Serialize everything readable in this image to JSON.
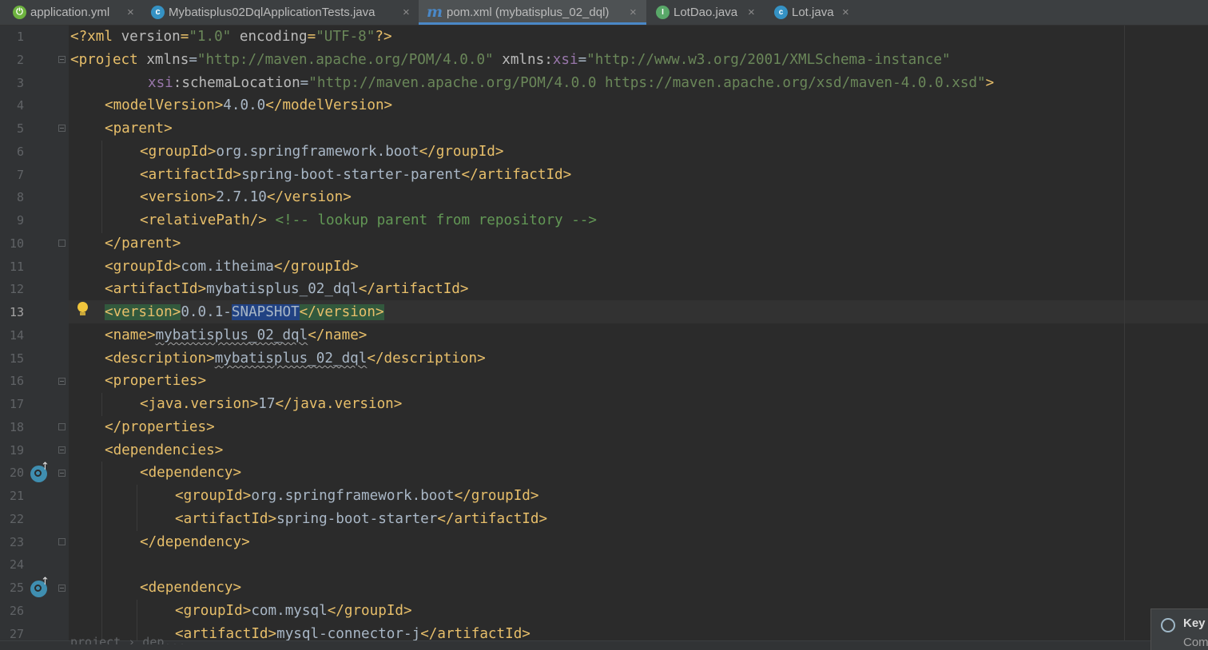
{
  "tabs": [
    {
      "label": "application.yml",
      "icon": "spring-boot-config-icon",
      "active": false
    },
    {
      "label": "Mybatisplus02DqlApplicationTests.java",
      "icon": "test-class-icon",
      "active": false
    },
    {
      "label": "pom.xml (mybatisplus_02_dql)",
      "icon": "maven-icon",
      "active": true
    },
    {
      "label": "LotDao.java",
      "icon": "interface-icon",
      "active": false
    },
    {
      "label": "Lot.java",
      "icon": "class-icon",
      "active": false
    }
  ],
  "tab_icon_glyphs": {
    "spring": "⏻",
    "test": "c",
    "iface": "I",
    "cls": "c",
    "maven": "m"
  },
  "close_glyph": "×",
  "line_numbers": [
    "1",
    "2",
    "3",
    "4",
    "5",
    "6",
    "7",
    "8",
    "9",
    "10",
    "11",
    "12",
    "13",
    "14",
    "15",
    "16",
    "17",
    "18",
    "19",
    "20",
    "21",
    "22",
    "23",
    "24",
    "25",
    "26",
    "27"
  ],
  "current_line": "13",
  "code": {
    "l1": {
      "open": "<?xml ",
      "a1": "version",
      "v1": "\"1.0\"",
      "a2": " encoding",
      "v2": "\"UTF-8\"",
      "close": "?>"
    },
    "l2": {
      "open": "<project ",
      "a1": "xmlns",
      "v1": "\"http://maven.apache.org/POM/4.0.0\"",
      "a2": " xmlns:",
      "ns": "xsi",
      "v2": "\"http://www.w3.org/2001/XMLSchema-instance\""
    },
    "l3": {
      "ns": "xsi",
      "a1": ":schemaLocation",
      "v1": "\"http://maven.apache.org/POM/4.0.0 https://maven.apache.org/xsd/maven-4.0.0.xsd\"",
      "close": ">"
    },
    "l4": {
      "open": "<modelVersion>",
      "text": "4.0.0",
      "close": "</modelVersion>"
    },
    "l5": {
      "open": "<parent>"
    },
    "l6": {
      "open": "<groupId>",
      "text": "org.springframework.boot",
      "close": "</groupId>"
    },
    "l7": {
      "open": "<artifactId>",
      "text": "spring-boot-starter-parent",
      "close": "</artifactId>"
    },
    "l8": {
      "open": "<version>",
      "text": "2.7.10",
      "close": "</version>"
    },
    "l9": {
      "open": "<relativePath/>",
      "comment": "<!-- lookup parent from repository -->"
    },
    "l10": {
      "close": "</parent>"
    },
    "l11": {
      "open": "<groupId>",
      "text": "com.itheima",
      "close": "</groupId>"
    },
    "l12": {
      "open": "<artifactId>",
      "text": "mybatisplus_02_dql",
      "close": "</artifactId>"
    },
    "l13": {
      "open": "<version>",
      "text_a": "0.0.1-",
      "text_sel": "SNAPSHOT",
      "close": "</version>"
    },
    "l14": {
      "open": "<name>",
      "text": "mybatisplus_02_dql",
      "close": "</name>"
    },
    "l15": {
      "open": "<description>",
      "text": "mybatisplus_02_dql",
      "close": "</description>"
    },
    "l16": {
      "open": "<properties>"
    },
    "l17": {
      "open": "<java.version>",
      "text": "17",
      "close": "</java.version>"
    },
    "l18": {
      "close": "</properties>"
    },
    "l19": {
      "open": "<dependencies>"
    },
    "l20": {
      "open": "<dependency>"
    },
    "l21": {
      "open": "<groupId>",
      "text": "org.springframework.boot",
      "close": "</groupId>"
    },
    "l22": {
      "open": "<artifactId>",
      "text": "spring-boot-starter",
      "close": "</artifactId>"
    },
    "l23": {
      "close": "</dependency>"
    },
    "l25": {
      "open": "<dependency>"
    },
    "l26": {
      "open": "<groupId>",
      "text": "com.mysql",
      "close": "</groupId>"
    },
    "l27": {
      "open": "<artifactId>",
      "text": "mysql-connector-j",
      "close": "</artifactId>"
    }
  },
  "breadcrumb_partial": "project  ›  dep...",
  "popup": {
    "title": "Key",
    "subtitle": "Com"
  }
}
